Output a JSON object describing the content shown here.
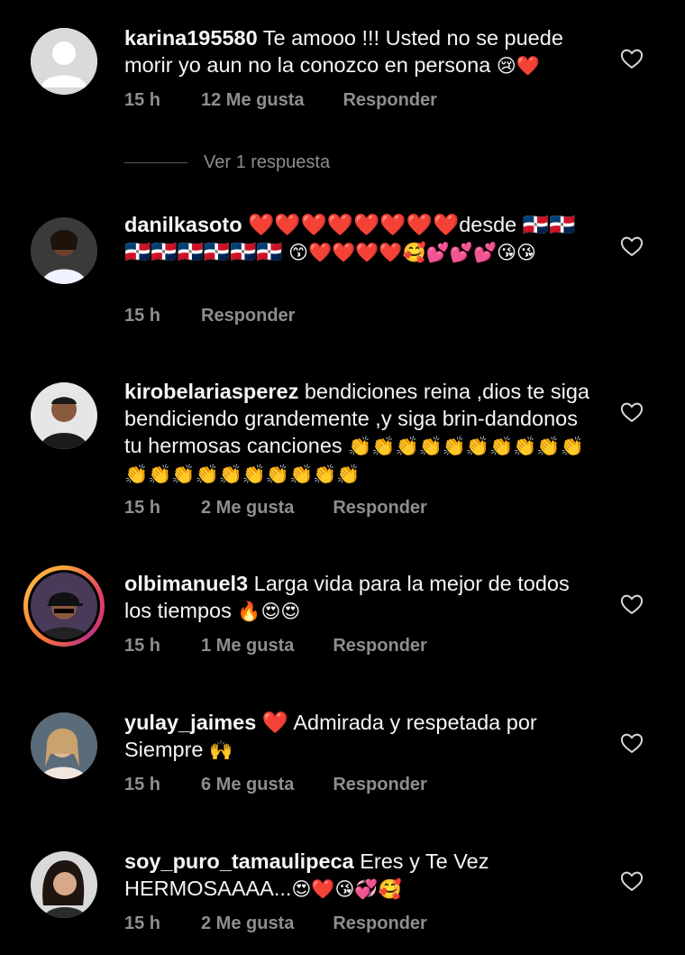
{
  "comments": [
    {
      "username": "karina195580",
      "text": " Te amooo !!! Usted no se puede morir yo aun no la conozco en persona ",
      "emojis": "😢❤️",
      "time": "15 h",
      "likes": "12 Me gusta",
      "reply": "Responder",
      "avatar": "default-avatar"
    },
    {
      "username": "danilkasoto",
      "text": " ❤️❤️❤️❤️❤️❤️❤️❤️desde 🇩🇴🇩🇴🇩🇴🇩🇴🇩🇴🇩🇴🇩🇴🇩🇴 ",
      "emojis": "😙❤️❤️❤️❤️🥰💕💕💕😘😘",
      "time": "15 h",
      "likes": "",
      "reply": "Responder",
      "avatar": "woman-white-shirt"
    },
    {
      "username": "kirobelariasperez",
      "text": " bendiciones reina ,dios te siga bendiciendo grandemente ,y siga brin-dandonos tu hermosas canciones ",
      "emojis": "👏👏👏👏👏👏👏👏👏👏👏👏👏👏👏👏👏👏👏👏",
      "time": "15 h",
      "likes": "2 Me gusta",
      "reply": "Responder",
      "avatar": "man-dark-jacket"
    },
    {
      "username": "olbimanuel3",
      "text": " Larga vida para la mejor de todos los tiempos ",
      "emojis": "🔥😍😍",
      "time": "15 h",
      "likes": "1 Me gusta",
      "reply": "Responder",
      "avatar": "man-cap-story-ring"
    },
    {
      "username": "yulay_jaimes",
      "text": " ❤️ Admirada y respetada por Siempre ",
      "emojis": "🙌",
      "time": "15 h",
      "likes": "6 Me gusta",
      "reply": "Responder",
      "avatar": "woman-blonde"
    },
    {
      "username": "soy_puro_tamaulipeca",
      "text": " Eres y Te Vez HERMOSAAAA...",
      "emojis": "😍❤️😘💞🥰",
      "time": "15 h",
      "likes": "2 Me gusta",
      "reply": "Responder",
      "avatar": "woman-dark-hair"
    }
  ],
  "view_replies": "Ver 1 respuesta",
  "colors": {
    "background": "#000000",
    "text": "#f5f5f5",
    "muted": "#8e8e8e"
  },
  "icons": {
    "like": "heart-outline-icon"
  }
}
